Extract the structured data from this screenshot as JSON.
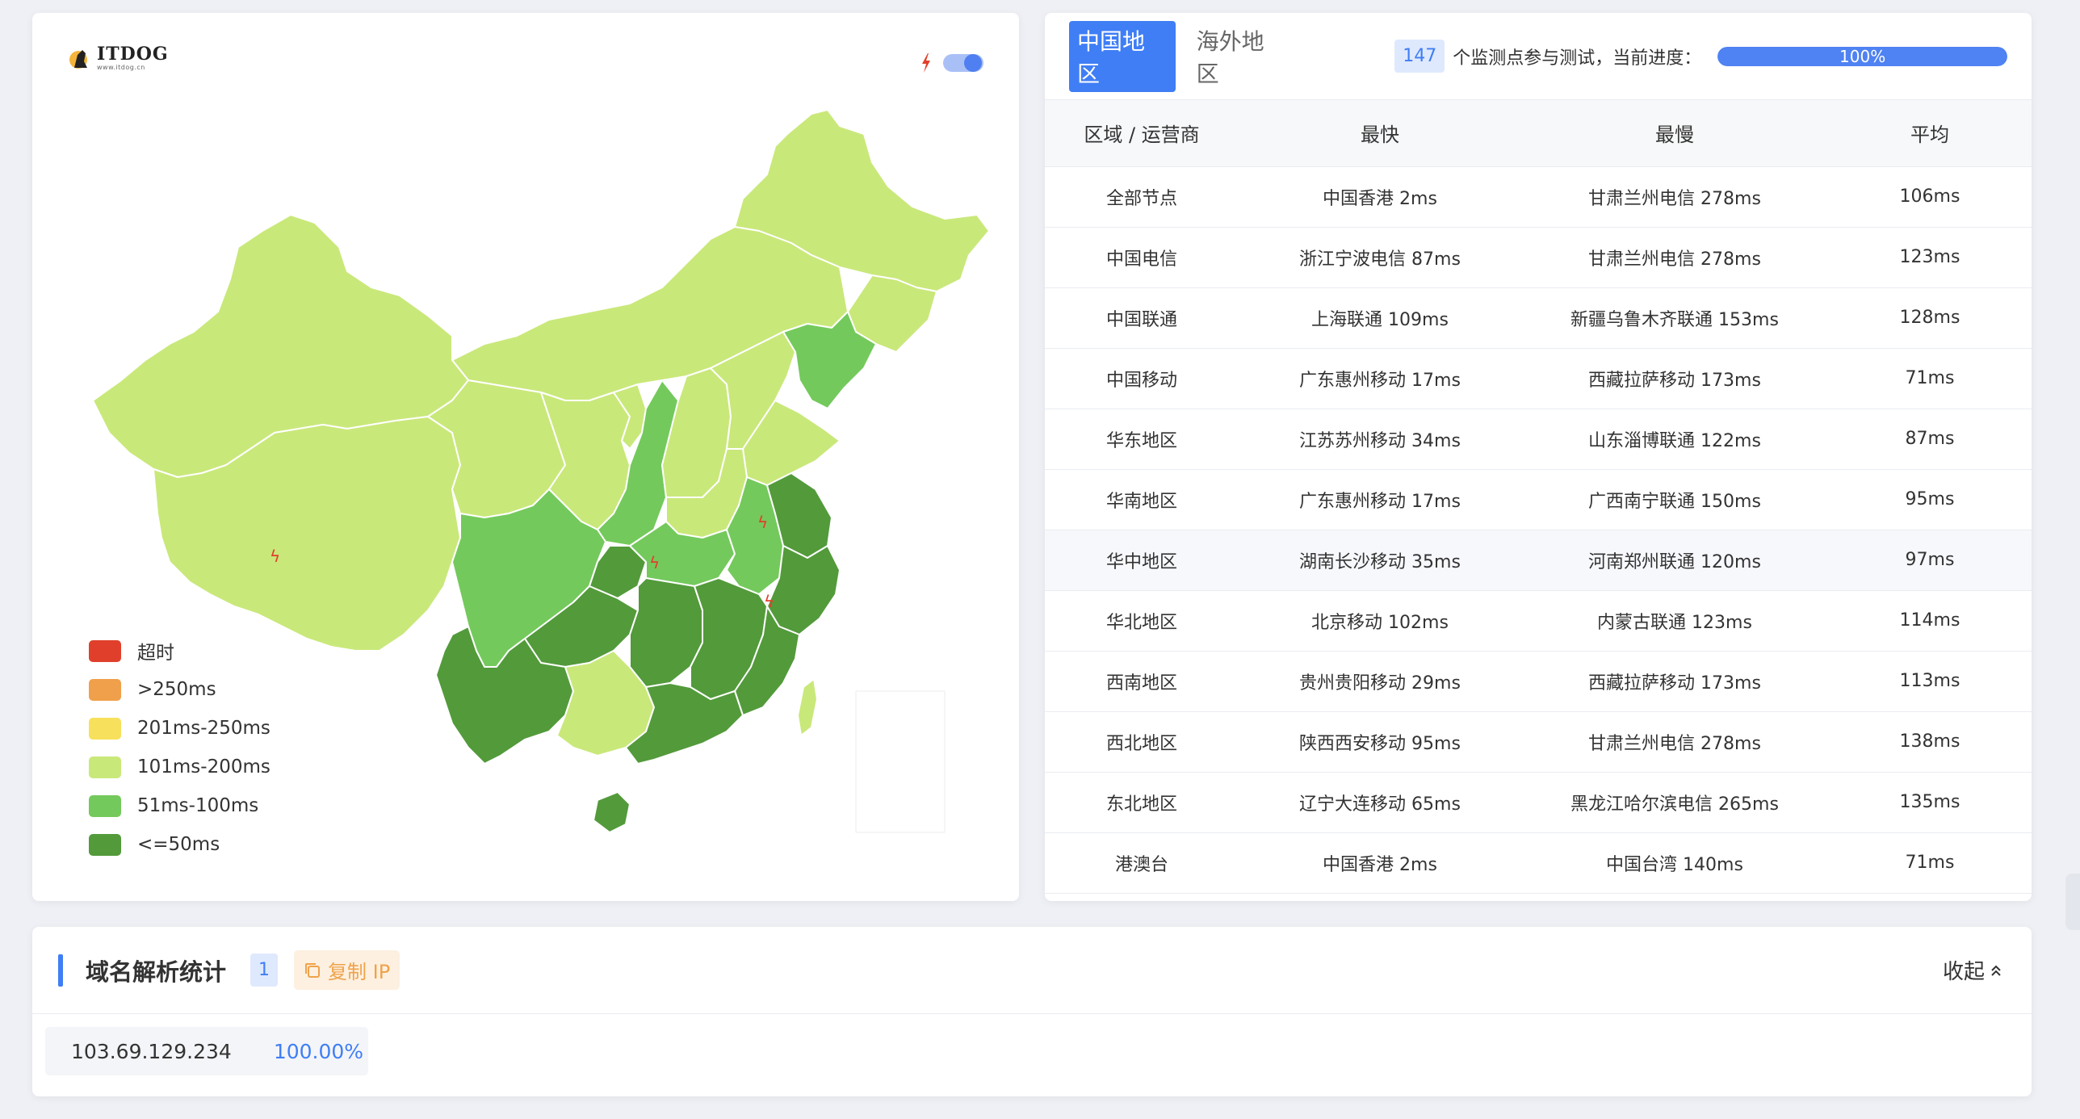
{
  "logo": {
    "name": "ITDOG",
    "sub": "www.itdog.cn"
  },
  "map": {
    "colors": {
      "timeout": "#e0402b",
      "gt250": "#f0a04a",
      "r201_250": "#f7e05b",
      "r101_200": "#c9e87a",
      "r51_100": "#74c95c",
      "le50": "#539a3b"
    }
  },
  "legend": [
    {
      "label": "超时",
      "color": "#e0402b"
    },
    {
      "label": ">250ms",
      "color": "#f0a04a"
    },
    {
      "label": "201ms-250ms",
      "color": "#f7e05b"
    },
    {
      "label": "101ms-200ms",
      "color": "#c9e87a"
    },
    {
      "label": "51ms-100ms",
      "color": "#74c95c"
    },
    {
      "label": "<=50ms",
      "color": "#539a3b"
    }
  ],
  "tabs": [
    {
      "label": "中国地区",
      "active": true
    },
    {
      "label": "海外地区",
      "active": false
    }
  ],
  "probe": {
    "count": "147",
    "text": "个监测点参与测试，当前进度：",
    "progress": 100,
    "progress_text": "100%"
  },
  "table": {
    "headers": [
      "区域 / 运营商",
      "最快",
      "最慢",
      "平均"
    ],
    "rows": [
      [
        "全部节点",
        "中国香港 2ms",
        "甘肃兰州电信 278ms",
        "106ms"
      ],
      [
        "中国电信",
        "浙江宁波电信 87ms",
        "甘肃兰州电信 278ms",
        "123ms"
      ],
      [
        "中国联通",
        "上海联通 109ms",
        "新疆乌鲁木齐联通 153ms",
        "128ms"
      ],
      [
        "中国移动",
        "广东惠州移动 17ms",
        "西藏拉萨移动 173ms",
        "71ms"
      ],
      [
        "华东地区",
        "江苏苏州移动 34ms",
        "山东淄博联通 122ms",
        "87ms"
      ],
      [
        "华南地区",
        "广东惠州移动 17ms",
        "广西南宁联通 150ms",
        "95ms"
      ],
      [
        "华中地区",
        "湖南长沙移动 35ms",
        "河南郑州联通 120ms",
        "97ms"
      ],
      [
        "华北地区",
        "北京移动 102ms",
        "内蒙古联通 123ms",
        "114ms"
      ],
      [
        "西南地区",
        "贵州贵阳移动 29ms",
        "西藏拉萨移动 173ms",
        "113ms"
      ],
      [
        "西北地区",
        "陕西西安移动 95ms",
        "甘肃兰州电信 278ms",
        "138ms"
      ],
      [
        "东北地区",
        "辽宁大连移动 65ms",
        "黑龙江哈尔滨电信 265ms",
        "135ms"
      ],
      [
        "港澳台",
        "中国香港 2ms",
        "中国台湾 140ms",
        "71ms"
      ]
    ]
  },
  "dns": {
    "title": "域名解析统计",
    "count": "1",
    "copy_label": "复制 IP",
    "collapse_label": "收起",
    "ip": "103.69.129.234",
    "pct": "100.00%"
  }
}
